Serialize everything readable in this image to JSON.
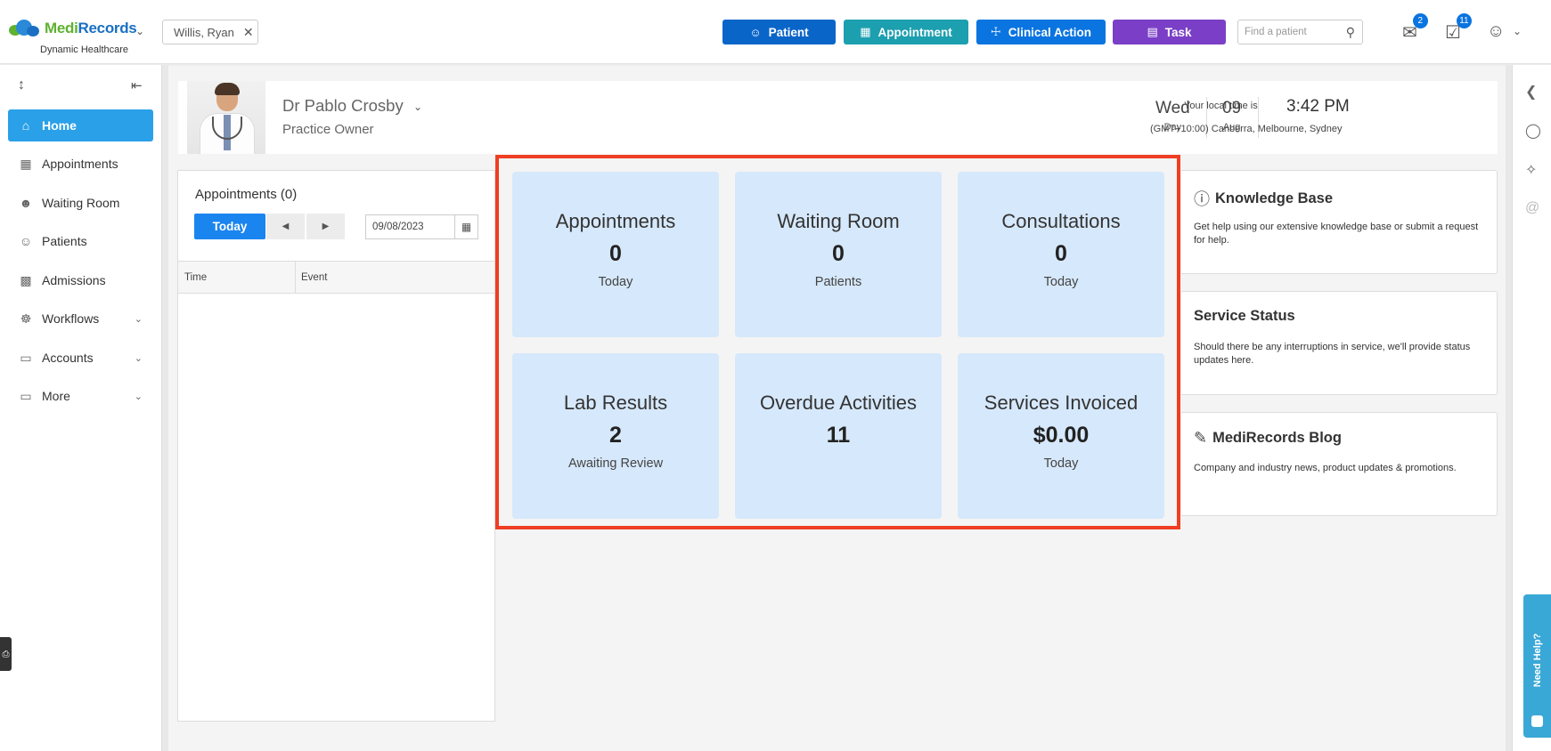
{
  "brand": {
    "logo_part1": "Medi",
    "logo_part2": "Records",
    "subtitle": "Dynamic Healthcare",
    "colors": {
      "green": "#5fb131",
      "blue": "#1a6fc2"
    }
  },
  "header": {
    "patient_chip": "Willis, Ryan",
    "buttons": {
      "patient": "Patient",
      "appointment": "Appointment",
      "clinical_action": "Clinical Action",
      "task": "Task"
    },
    "search_placeholder": "Find a patient",
    "mail_badge": "2",
    "tasks_badge": "11"
  },
  "sidebar": {
    "items": [
      {
        "label": "Home",
        "icon": "home-icon"
      },
      {
        "label": "Appointments",
        "icon": "calendar-icon"
      },
      {
        "label": "Waiting Room",
        "icon": "people-icon"
      },
      {
        "label": "Patients",
        "icon": "patients-icon"
      },
      {
        "label": "Admissions",
        "icon": "building-icon"
      },
      {
        "label": "Workflows",
        "icon": "workflow-icon"
      },
      {
        "label": "Accounts",
        "icon": "folder-icon"
      },
      {
        "label": "More",
        "icon": "folder-plus-icon"
      }
    ]
  },
  "profile": {
    "name": "Dr Pablo Crosby",
    "role": "Practice Owner",
    "day": "Wed",
    "day_label": "Day",
    "date": "09",
    "month": "Aug",
    "time_label": "Your local time is",
    "time": "3:42 PM",
    "timezone": "(GMT+10:00) Canberra, Melbourne, Sydney"
  },
  "appointments_panel": {
    "title": "Appointments (0)",
    "today_label": "Today",
    "date_value": "09/08/2023",
    "col_time": "Time",
    "col_event": "Event"
  },
  "stats": [
    {
      "title": "Appointments",
      "value": "0",
      "sub": "Today"
    },
    {
      "title": "Waiting Room",
      "value": "0",
      "sub": "Patients"
    },
    {
      "title": "Consultations",
      "value": "0",
      "sub": "Today"
    },
    {
      "title": "Lab Results",
      "value": "2",
      "sub": "Awaiting Review"
    },
    {
      "title": "Overdue Activities",
      "value": "11",
      "sub": ""
    },
    {
      "title": "Services Invoiced",
      "value": "$0.00",
      "sub": "Today"
    }
  ],
  "right_cards": {
    "knowledge": {
      "title": "Knowledge Base",
      "desc": "Get help using our extensive knowledge base or submit a request for help."
    },
    "status": {
      "title": "Service Status",
      "desc": "Should there be any interruptions in service, we'll provide status updates here."
    },
    "blog": {
      "title": "MediRecords Blog",
      "desc": "Company and industry news, product updates & promotions."
    }
  },
  "need_help": "Need Help?"
}
